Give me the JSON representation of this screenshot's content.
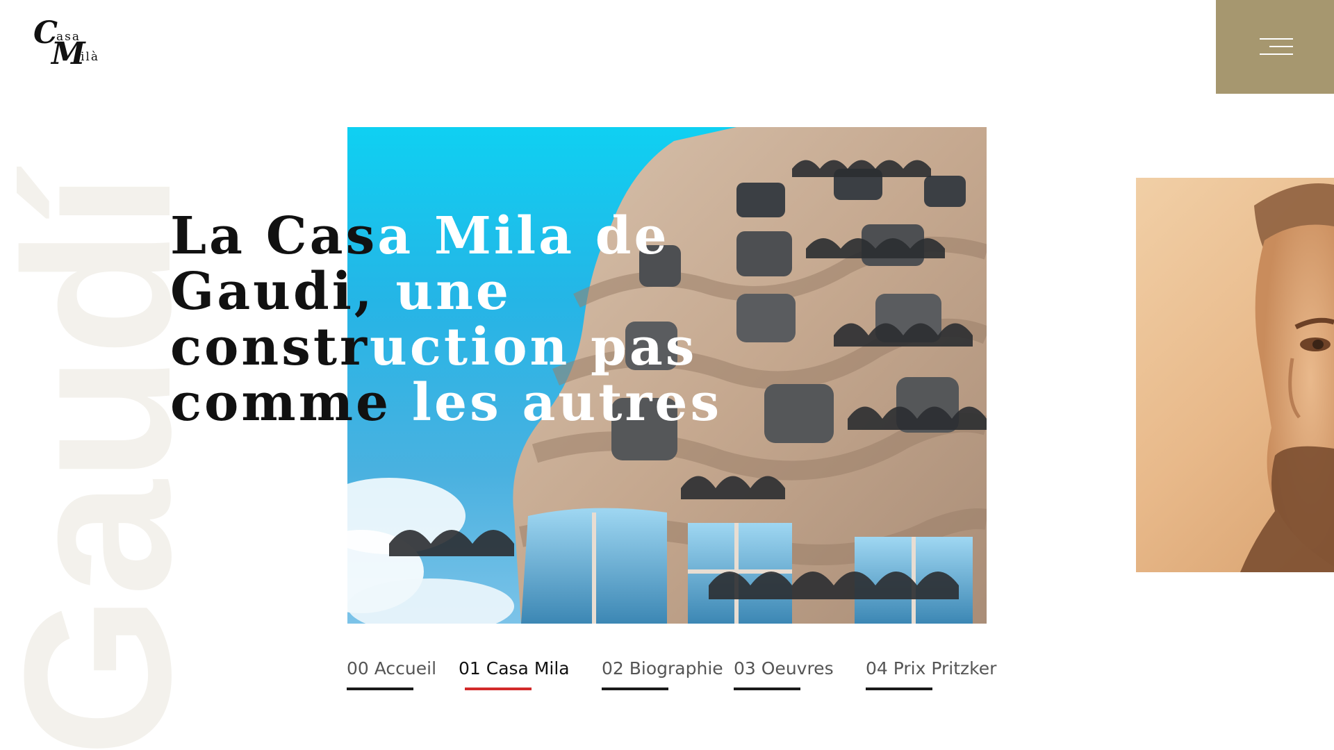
{
  "logo": {
    "big_c": "C",
    "small_top": "asa",
    "big_m": "M",
    "small_bottom": "ilà"
  },
  "menu": {
    "icon": "hamburger-menu-icon",
    "bg_color": "#a6976f"
  },
  "background_word": "Gaudí",
  "headline": {
    "line1_dark": "La Cas",
    "line1_light": "a Mila de",
    "line2_dark": "Gaudi,",
    "line2_light": " une",
    "line3_dark": "constr",
    "line3_light": "uction pas",
    "line4_dark": "comme",
    "line4_light": " les autres"
  },
  "nav": {
    "items": [
      {
        "label": "00 Accueil",
        "active": false
      },
      {
        "label": "01 Casa Mila",
        "active": true
      },
      {
        "label": "02 Biographie",
        "active": false
      },
      {
        "label": "03 Oeuvres",
        "active": false
      },
      {
        "label": "04 Prix Pritzker",
        "active": false
      }
    ]
  },
  "colors": {
    "accent": "#a6976f",
    "active_underline": "#d22a2a",
    "underline": "#1b1b1b",
    "background_word": "#f3f1ec"
  }
}
